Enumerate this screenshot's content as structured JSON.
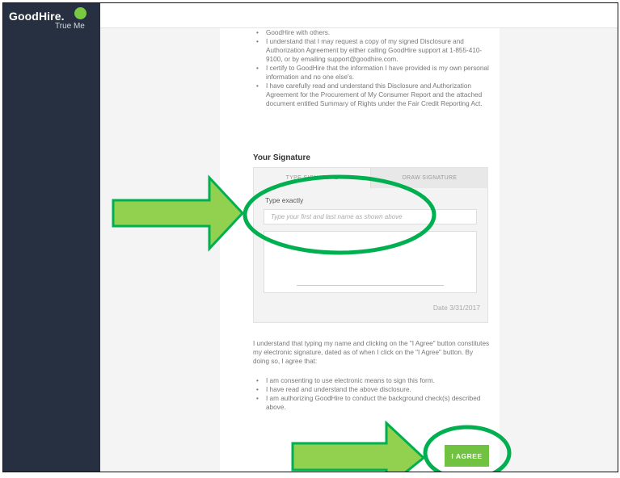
{
  "brand": {
    "logo_text": "GoodHire.",
    "tagline": "True Me",
    "accent_color": "#7ac943"
  },
  "sidebar": {
    "background": "#263040"
  },
  "disclosure": {
    "items_top": [
      "GoodHire with others.",
      "I understand that I may request a copy of my signed Disclosure and Authorization Agreement by either calling GoodHire support at 1-855-410-9100, or by emailing support@goodhire.com.",
      "I certify to GoodHire that the information I have provided is my own personal information and no one else's.",
      "I have carefully read and understand this Disclosure and Authorization Agreement for the Procurement of My Consumer Report and the attached document entitled Summary of Rights under the Fair Credit Reporting Act."
    ]
  },
  "signature": {
    "heading": "Your Signature",
    "tab_type": "TYPE SIGNATURE",
    "tab_draw": "DRAW SIGNATURE",
    "type_label": "Type exactly",
    "input_placeholder": "Type your first and last name as shown above",
    "input_value": "",
    "date": "Date 3/31/2017"
  },
  "consent": {
    "paragraph": "I understand that typing my name and clicking on the \"I Agree\" button constitutes my electronic signature, dated as of when I click on the \"I Agree\" button. By doing so, I agree that:",
    "items": [
      "I am consenting to use electronic means to sign this form.",
      "I have read and understand the above disclosure.",
      "I am authorizing GoodHire to conduct the background check(s) described above."
    ]
  },
  "actions": {
    "agree_label": "I AGREE",
    "agree_color": "#71c241"
  },
  "annotations": {
    "arrow_fill": "#92d050",
    "outline_color": "#00b050"
  }
}
